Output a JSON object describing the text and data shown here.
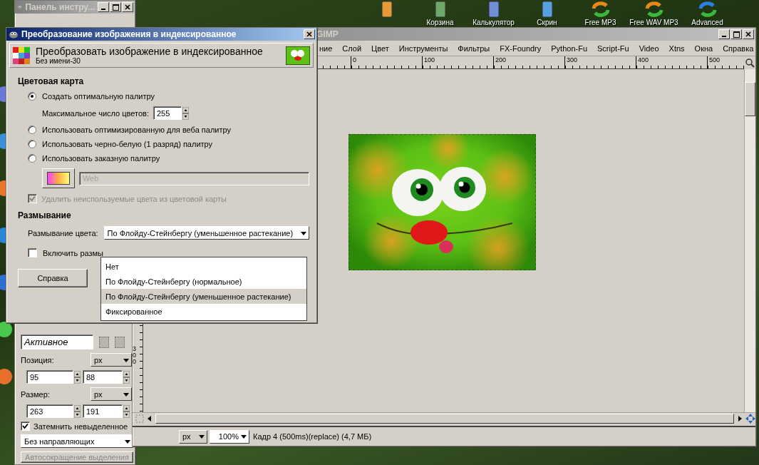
{
  "desktop": {
    "top_icons": [
      {
        "kind": "phone"
      },
      {
        "kind": "bin",
        "label": "Корзина"
      },
      {
        "kind": "calc",
        "label": "Калькулятор"
      },
      {
        "kind": "pda",
        "label": "Скрин"
      },
      {
        "kind": "convert",
        "label": "Free MP3"
      },
      {
        "kind": "convert",
        "label": "Free WAV MP3"
      },
      {
        "kind": "refresh",
        "label": "Advanced"
      }
    ]
  },
  "toolbox": {
    "title": "Панель инстру...",
    "mode": "Активное",
    "position": {
      "label": "Позиция:",
      "unit": "px",
      "values": [
        "95",
        "88"
      ]
    },
    "size": {
      "label": "Размер:",
      "unit": "px",
      "values": [
        "263",
        "191"
      ]
    },
    "highlight": {
      "label": "Затемнить невыделенное",
      "checked": true
    },
    "guides": "Без направляющих",
    "autoshrink": {
      "label": "Автосокращение выделения",
      "disabled": true
    }
  },
  "image_window": {
    "title": "GIMP",
    "menu": [
      "ние",
      "Слой",
      "Цвет",
      "Инструменты",
      "Фильтры",
      "FX-Foundry",
      "Python-Fu",
      "Script-Fu",
      "Video",
      "Xtns",
      "Окна",
      "Справка"
    ],
    "ruler_labels": [
      "0",
      "100",
      "200",
      "300",
      "400",
      "500"
    ],
    "vertical_ruler_label": "300",
    "status": {
      "unit": "px",
      "zoom": "100%",
      "message": "Кадр 4  (500ms)(replace) (4,7 МБ)"
    }
  },
  "dialog": {
    "title": "Преобразование изображения в индексированное",
    "heading": "Преобразовать изображение в индексированное",
    "subtitle": "Без имени-30",
    "colormap": {
      "heading": "Цветовая карта",
      "options": [
        {
          "label": "Создать оптимальную палитру",
          "selected": true,
          "max_colors": {
            "label": "Максимальное число цветов:",
            "value": "255"
          }
        },
        {
          "label": "Использовать оптимизированную для веба палитру",
          "selected": false
        },
        {
          "label": "Использовать черно-белую (1 разряд) палитру",
          "selected": false
        },
        {
          "label": "Использовать заказную палитру",
          "selected": false,
          "palette": {
            "value": "Web",
            "disabled": true
          }
        }
      ],
      "remove_unused": {
        "label": "Удалить неиспользуемые цвета из цветовой карты",
        "checked": true,
        "disabled": true
      }
    },
    "dithering": {
      "heading": "Размывание",
      "color_label": "Размывание цвета:",
      "color_value": "По Флойду-Стейнбергу (уменьшенное растекание)",
      "transparency": {
        "label": "Включить размы",
        "checked": false
      }
    },
    "buttons": [
      "Справка"
    ]
  },
  "dither_menu": {
    "options": [
      {
        "label": "Нет",
        "selected": false
      },
      {
        "label": "По Флойду-Стейнбергу (нормальное)",
        "selected": false
      },
      {
        "label": "По Флойду-Стейнбергу (уменьшенное растекание)",
        "selected": true
      },
      {
        "label": "Фиксированное",
        "selected": false
      }
    ]
  }
}
